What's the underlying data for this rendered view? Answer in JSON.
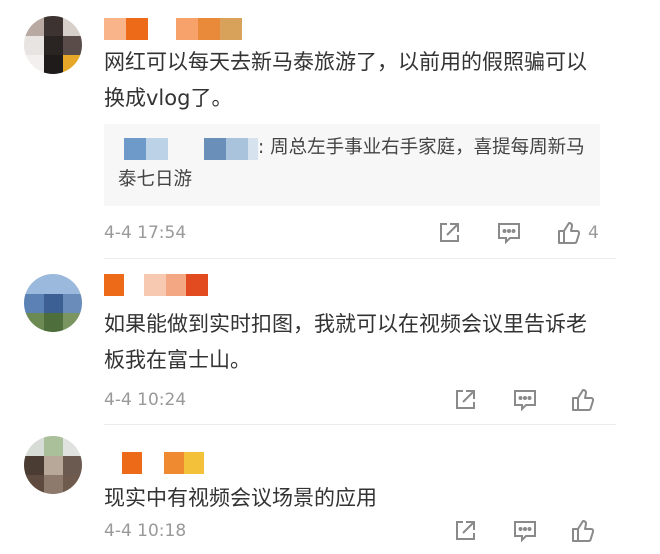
{
  "colors": {
    "text": "#333333",
    "meta": "#999999",
    "icon": "#8a8a8a",
    "quote_bg": "#f7f7f7"
  },
  "comments": [
    {
      "text": "网红可以每天去新马泰旅游了，以前用的假照骗可以换成vlog了。",
      "quote": ": 周总左手事业右手家庭，喜提每周新马泰七日游",
      "time": "4-4 17:54",
      "like_count": "4",
      "icons": [
        "share-icon",
        "comment-icon",
        "like-icon"
      ]
    },
    {
      "text": "如果能做到实时扣图，我就可以在视频会议里告诉老板我在富士山。",
      "time": "4-4 10:24",
      "icons": [
        "share-icon",
        "comment-icon",
        "like-icon"
      ]
    },
    {
      "text": "现实中有视频会议场景的应用",
      "time": "4-4 10:18",
      "icons": [
        "share-icon",
        "comment-icon",
        "like-icon"
      ]
    }
  ]
}
